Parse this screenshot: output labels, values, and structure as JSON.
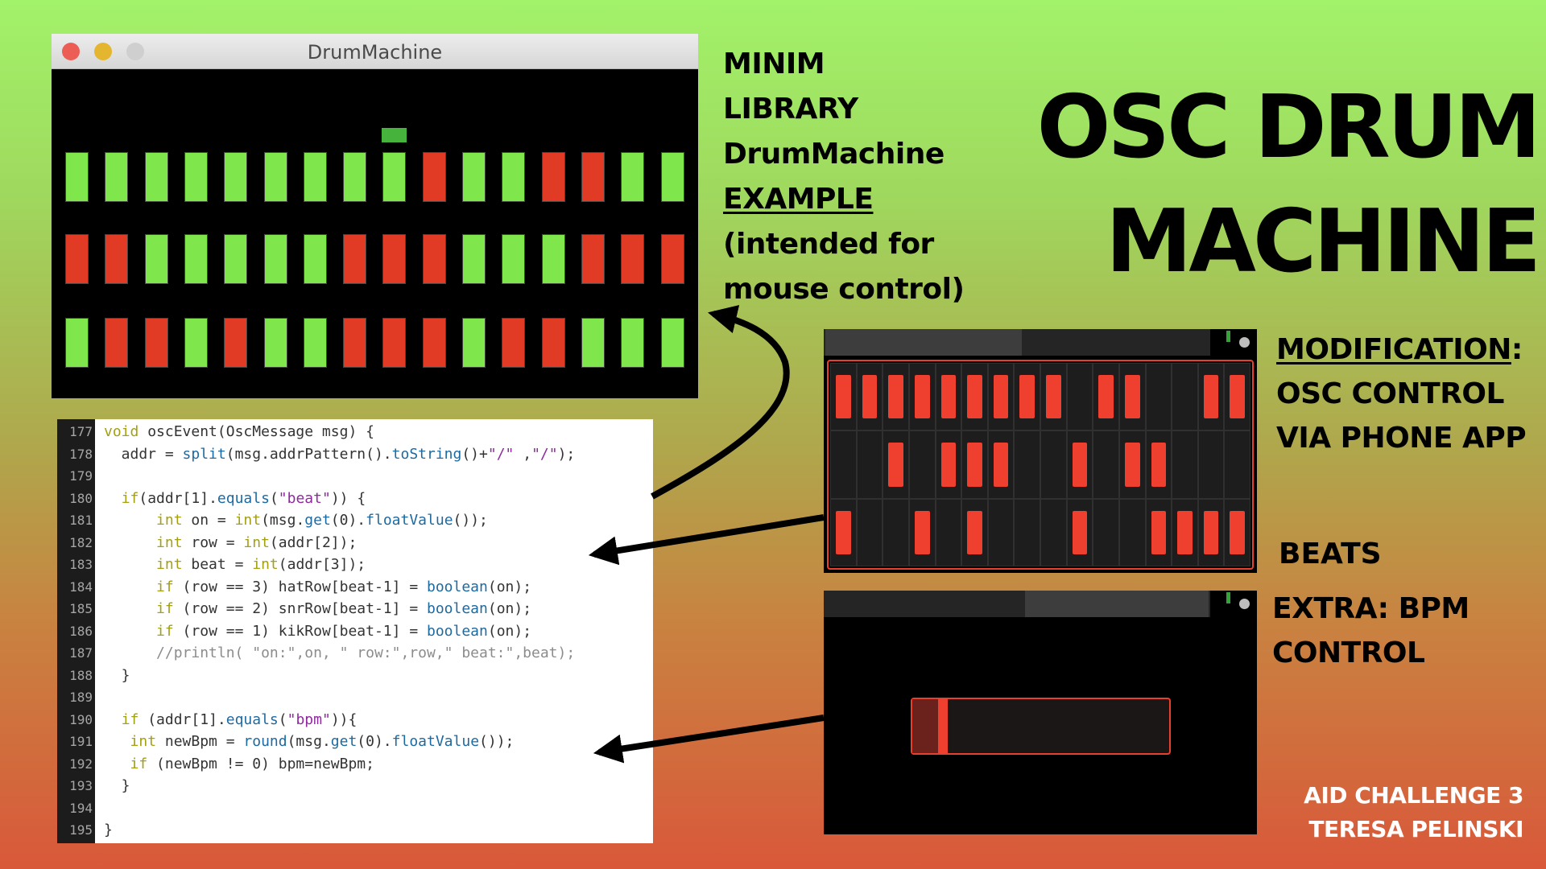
{
  "window": {
    "title": "DrumMachine",
    "traffic_colors": [
      "#ec5d55",
      "#e4b52f",
      "#cfcfcf"
    ],
    "colors": {
      "on": "#7fe64c",
      "off": "#e13b25",
      "cursor": "#45b33c"
    },
    "rows": [
      [
        1,
        1,
        1,
        1,
        1,
        1,
        1,
        1,
        1,
        0,
        1,
        1,
        0,
        0,
        1,
        1
      ],
      [
        0,
        0,
        1,
        1,
        1,
        1,
        1,
        0,
        0,
        0,
        1,
        1,
        1,
        0,
        0,
        0
      ],
      [
        1,
        0,
        0,
        1,
        0,
        1,
        1,
        0,
        0,
        0,
        1,
        0,
        0,
        1,
        1,
        1
      ]
    ],
    "current_step": 8
  },
  "minim_lines": [
    "MINIM",
    "LIBRARY",
    "DrumMachine",
    "EXAMPLE",
    "(intended for",
    "mouse control)"
  ],
  "title": [
    "OSC DRUM",
    "MACHINE"
  ],
  "modification": {
    "heading": "MODIFICATION",
    "colon": ":",
    "lines": [
      "OSC CONTROL",
      "VIA PHONE APP"
    ]
  },
  "beats_label": "BEATS",
  "bpm_lines": [
    "EXTRA: BPM",
    "CONTROL"
  ],
  "credits": [
    "AID CHALLENGE 3",
    "TERESA PELINSKI"
  ],
  "code": {
    "lines": [
      {
        "n": "177",
        "t": "void oscEvent(OscMessage msg) {"
      },
      {
        "n": "178",
        "t": "  addr = split(msg.addrPattern().toString()+\"/\" ,\"/\");"
      },
      {
        "n": "179",
        "t": ""
      },
      {
        "n": "180",
        "t": "  if(addr[1].equals(\"beat\")) {"
      },
      {
        "n": "181",
        "t": "      int on = int(msg.get(0).floatValue());"
      },
      {
        "n": "182",
        "t": "      int row = int(addr[2]);"
      },
      {
        "n": "183",
        "t": "      int beat = int(addr[3]);"
      },
      {
        "n": "184",
        "t": "      if (row == 3) hatRow[beat-1] = boolean(on);"
      },
      {
        "n": "185",
        "t": "      if (row == 2) snrRow[beat-1] = boolean(on);"
      },
      {
        "n": "186",
        "t": "      if (row == 1) kikRow[beat-1] = boolean(on);"
      },
      {
        "n": "187",
        "t": "      //println( \"on:\",on, \" row:\",row,\" beat:\",beat);"
      },
      {
        "n": "188",
        "t": "  }"
      },
      {
        "n": "189",
        "t": ""
      },
      {
        "n": "190",
        "t": "  if (addr[1].equals(\"bpm\")){"
      },
      {
        "n": "191",
        "t": "   int newBpm = round(msg.get(0).floatValue());"
      },
      {
        "n": "192",
        "t": "   if (newBpm != 0) bpm=newBpm;"
      },
      {
        "n": "193",
        "t": "  }"
      },
      {
        "n": "194",
        "t": ""
      },
      {
        "n": "195",
        "t": "}"
      }
    ]
  },
  "phone_beats": {
    "rows": [
      [
        1,
        1,
        1,
        1,
        1,
        1,
        1,
        1,
        1,
        0,
        1,
        1,
        0,
        0,
        1,
        1
      ],
      [
        0,
        0,
        1,
        0,
        1,
        1,
        1,
        0,
        0,
        1,
        0,
        1,
        1,
        0,
        0,
        0
      ],
      [
        1,
        0,
        0,
        1,
        0,
        1,
        0,
        0,
        0,
        1,
        0,
        0,
        1,
        1,
        1,
        1
      ]
    ]
  },
  "phone_bpm": {
    "value_fraction": 0.1
  }
}
